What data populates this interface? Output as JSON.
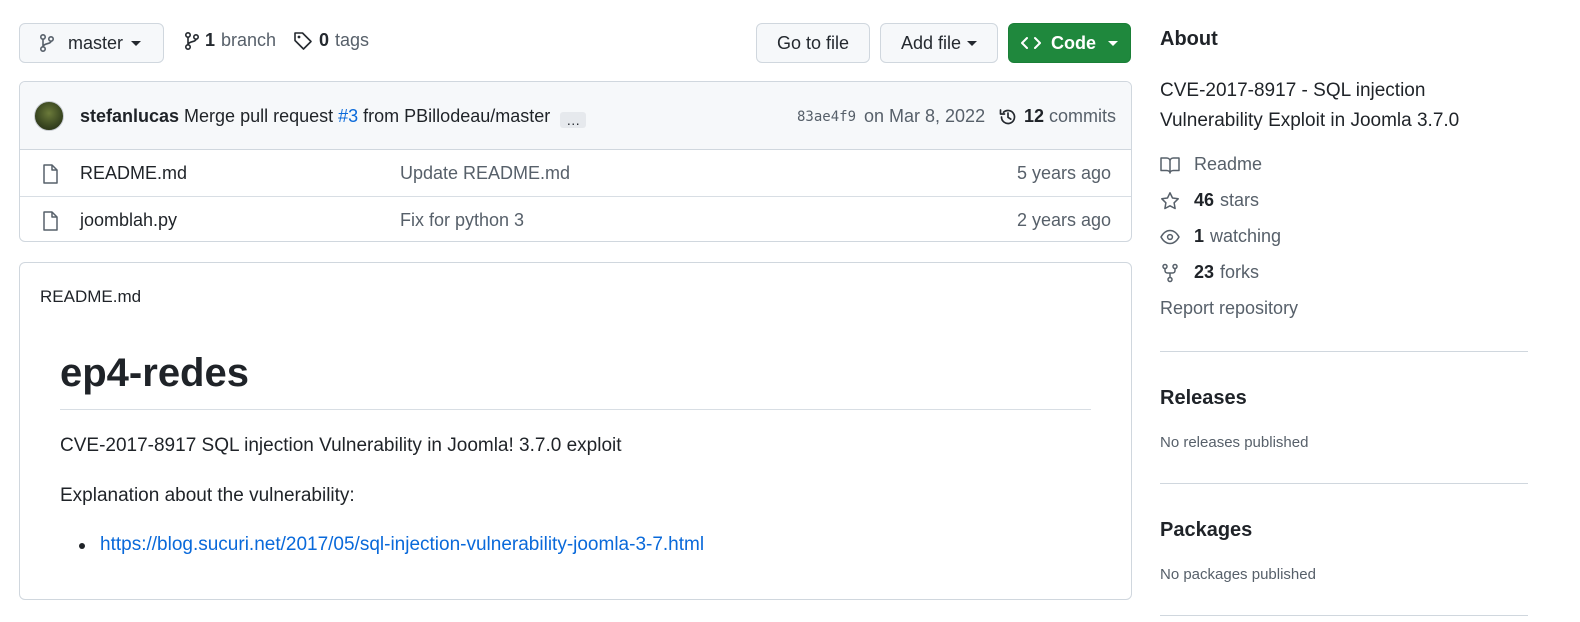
{
  "toolbar": {
    "branch_name": "master",
    "branch_count": "1",
    "branch_label": "branch",
    "tag_count": "0",
    "tag_label": "tags",
    "go_to_file": "Go to file",
    "add_file": "Add file",
    "code": "Code"
  },
  "commit": {
    "author": "stefanlucas",
    "message_prefix": "Merge pull request",
    "pr_link": "#3",
    "message_suffix": "from PBillodeau/master",
    "ellipsis": "…",
    "sha": "83ae4f9",
    "date": "on Mar 8, 2022",
    "commit_count": "12",
    "commit_label": "commits"
  },
  "files": [
    {
      "name": "README.md",
      "message": "Update README.md",
      "age": "5 years ago"
    },
    {
      "name": "joomblah.py",
      "message": "Fix for python 3",
      "age": "2 years ago"
    }
  ],
  "readme": {
    "filename": "README.md",
    "heading": "ep4-redes",
    "para1": "CVE-2017-8917 SQL injection Vulnerability in Joomla! 3.7.0 exploit",
    "para2": "Explanation about the vulnerability:",
    "link": "https://blog.sucuri.net/2017/05/sql-injection-vulnerability-joomla-3-7.html"
  },
  "sidebar": {
    "about_title": "About",
    "description_line1": "CVE-2017-8917 - SQL injection",
    "description_line2": "Vulnerability Exploit in Joomla 3.7.0",
    "readme": "Readme",
    "stars_count": "46",
    "stars_label": "stars",
    "watching_count": "1",
    "watching_label": "watching",
    "forks_count": "23",
    "forks_label": "forks",
    "report": "Report repository",
    "releases_title": "Releases",
    "releases_empty": "No releases published",
    "packages_title": "Packages",
    "packages_empty": "No packages published"
  },
  "colors": {
    "accent_link": "#0969da",
    "code_button": "#1f883d",
    "border": "#d0d7de",
    "muted_text": "#57606a"
  }
}
